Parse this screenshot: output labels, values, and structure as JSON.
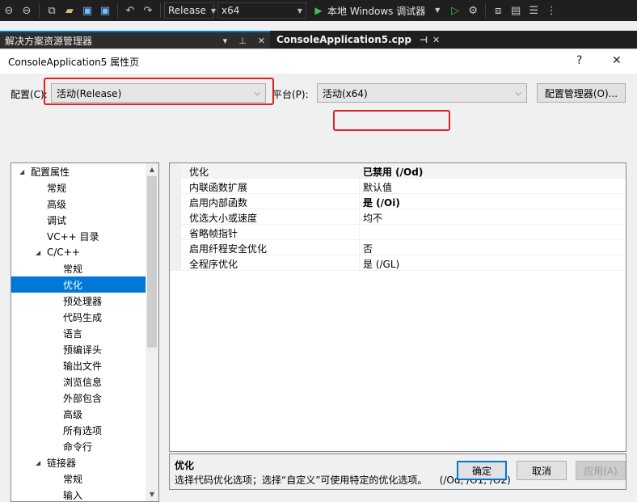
{
  "toolbar": {
    "config_value": "Release",
    "platform_value": "x64",
    "run_label": "本地 Windows 调试器"
  },
  "tabs": {
    "explorer": "解决方案资源管理器",
    "file": "ConsoleApplication5.cpp"
  },
  "dialog": {
    "title": "ConsoleApplication5 属性页",
    "help": "?",
    "close": "✕",
    "config_label": "配置(C):",
    "config_value": "活动(Release)",
    "platform_label": "平台(P):",
    "platform_value": "活动(x64)",
    "config_manager": "配置管理器(O)...",
    "ok": "确定",
    "cancel": "取消",
    "apply": "应用(A)"
  },
  "tree": [
    {
      "label": "配置属性",
      "level": 0,
      "expanded": true
    },
    {
      "label": "常规",
      "level": 1
    },
    {
      "label": "高级",
      "level": 1
    },
    {
      "label": "调试",
      "level": 1
    },
    {
      "label": "VC++ 目录",
      "level": 1
    },
    {
      "label": "C/C++",
      "level": 1,
      "expanded": true
    },
    {
      "label": "常规",
      "level": 2
    },
    {
      "label": "优化",
      "level": 2,
      "selected": true
    },
    {
      "label": "预处理器",
      "level": 2
    },
    {
      "label": "代码生成",
      "level": 2
    },
    {
      "label": "语言",
      "level": 2
    },
    {
      "label": "预编译头",
      "level": 2
    },
    {
      "label": "输出文件",
      "level": 2
    },
    {
      "label": "浏览信息",
      "level": 2
    },
    {
      "label": "外部包含",
      "level": 2
    },
    {
      "label": "高级",
      "level": 2
    },
    {
      "label": "所有选项",
      "level": 2
    },
    {
      "label": "命令行",
      "level": 2
    },
    {
      "label": "链接器",
      "level": 1,
      "expanded": true
    },
    {
      "label": "常规",
      "level": 2
    },
    {
      "label": "输入",
      "level": 2
    }
  ],
  "properties": [
    {
      "name": "优化",
      "value": "已禁用 (/Od)",
      "bold": true
    },
    {
      "name": "内联函数扩展",
      "value": "默认值",
      "bold": false
    },
    {
      "name": "启用内部函数",
      "value": "是 (/Oi)",
      "bold": true
    },
    {
      "name": "优选大小或速度",
      "value": "均不",
      "bold": false
    },
    {
      "name": "省略帧指针",
      "value": "",
      "bold": false
    },
    {
      "name": "启用纤程安全优化",
      "value": "否",
      "bold": false
    },
    {
      "name": "全程序优化",
      "value": "是 (/GL)",
      "bold": false
    }
  ],
  "description": {
    "title": "优化",
    "text": "选择代码优化选项；选择“自定义”可使用特定的优化选项。    (/Od, /O1, /O2)"
  },
  "colors": {
    "selection": "#0078d7",
    "highlight_box": "#e02020",
    "vs_dark": "#1f1f1f"
  }
}
